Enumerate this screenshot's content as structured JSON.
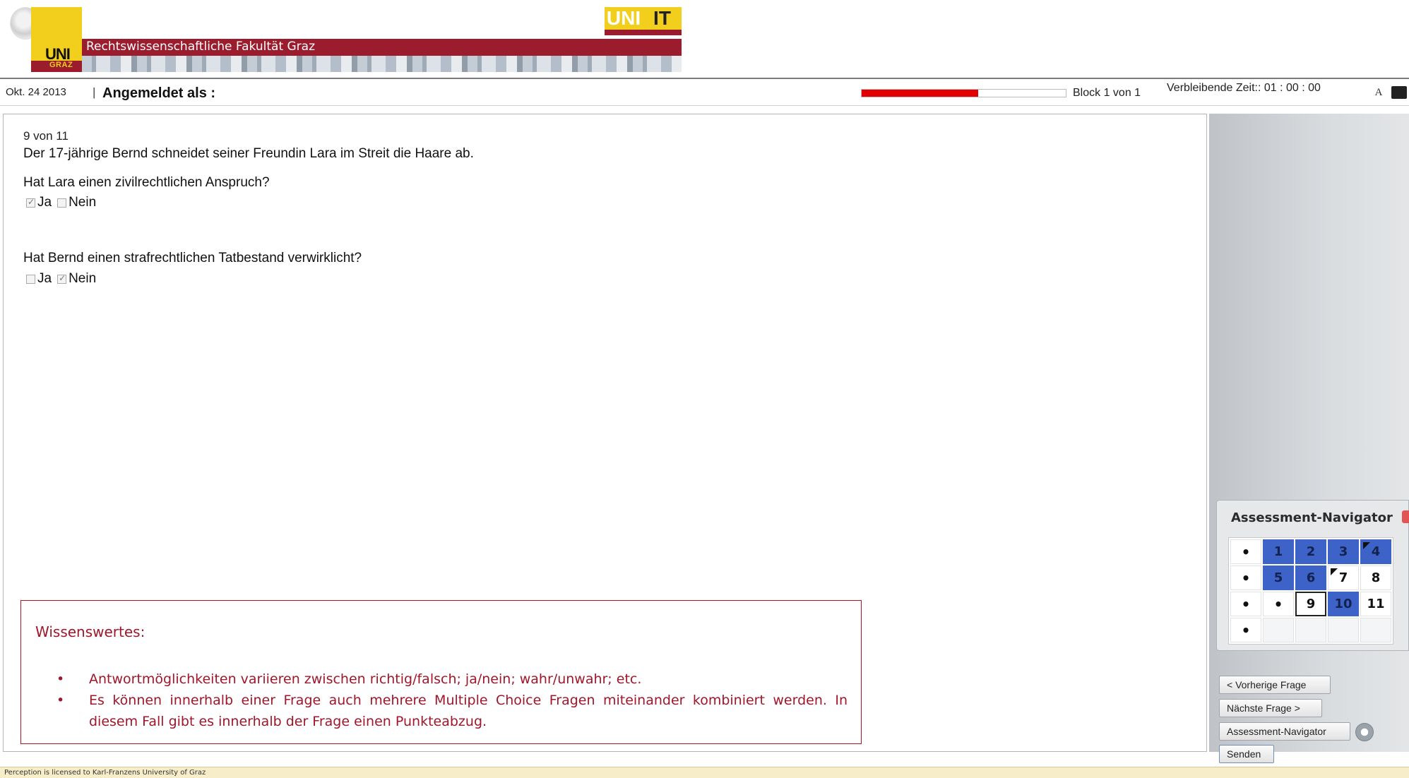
{
  "header": {
    "faculty_title": "Rechtswissenschaftliche Fakultät Graz",
    "uni_logo": "UNI",
    "graz_logo": "GRAZ",
    "unit_logo_uni": "UNI",
    "unit_logo_it": "IT"
  },
  "status": {
    "date": "Okt. 24 2013",
    "separator": "|",
    "logged_in_label": "Angemeldet als :",
    "progress_fraction": 0.57,
    "block_label": "Block 1 von 1",
    "time_label": "Verbleibende Zeit:: 01 : 00 : 00",
    "font_button_label": "A"
  },
  "question": {
    "counter": "9  von 11",
    "text": "Der 17-jährige Bernd schneidet seiner Freundin Lara im Streit die Haare ab.",
    "subquestions": [
      {
        "text": "Hat Lara einen zivilrechtlichen Anspruch?",
        "options": [
          {
            "label": "Ja",
            "checked": true
          },
          {
            "label": "Nein",
            "checked": false
          }
        ]
      },
      {
        "text": "Hat Bernd einen strafrechtlichen Tatbestand verwirklicht?",
        "options": [
          {
            "label": "Ja",
            "checked": false
          },
          {
            "label": "Nein",
            "checked": true
          }
        ]
      }
    ]
  },
  "info": {
    "title": "Wissenswertes:",
    "bullets": [
      "Antwortmöglichkeiten variieren zwischen richtig/falsch; ja/nein; wahr/unwahr; etc.",
      "Es können innerhalb einer Frage auch mehrere Multiple Choice Fragen miteinander kombiniert werden. In diesem Fall gibt es innerhalb der Frage einen Punkteabzug."
    ]
  },
  "navigator": {
    "title": "Assessment-Navigator",
    "cells": [
      {
        "label": "•",
        "state": "dot"
      },
      {
        "label": "1",
        "state": "answered"
      },
      {
        "label": "2",
        "state": "answered"
      },
      {
        "label": "3",
        "state": "answered"
      },
      {
        "label": "4",
        "state": "answered-flagged"
      },
      {
        "label": "•",
        "state": "dot"
      },
      {
        "label": "5",
        "state": "answered"
      },
      {
        "label": "6",
        "state": "answered"
      },
      {
        "label": "7",
        "state": "flagged"
      },
      {
        "label": "8",
        "state": "open"
      },
      {
        "label": "•",
        "state": "dot"
      },
      {
        "label": "•",
        "state": "dot"
      },
      {
        "label": "9",
        "state": "current"
      },
      {
        "label": "10",
        "state": "answered"
      },
      {
        "label": "11",
        "state": "open"
      },
      {
        "label": "•",
        "state": "dot"
      },
      {
        "label": "",
        "state": "empty"
      },
      {
        "label": "",
        "state": "empty"
      },
      {
        "label": "",
        "state": "empty"
      },
      {
        "label": "",
        "state": "empty"
      }
    ]
  },
  "buttons": {
    "prev": "< Vorherige Frage",
    "next": "Nächste Frage >",
    "navigator": "Assessment-Navigator",
    "send": "Senden"
  },
  "footer": {
    "text": "Perception is licensed to Karl-Franzens University of Graz"
  },
  "colors": {
    "brand_red": "#9b1c2d",
    "brand_gold": "#f2cf1c",
    "progress_red": "#e20000",
    "answered_blue": "#3d63c9",
    "info_text": "#a0162a"
  }
}
